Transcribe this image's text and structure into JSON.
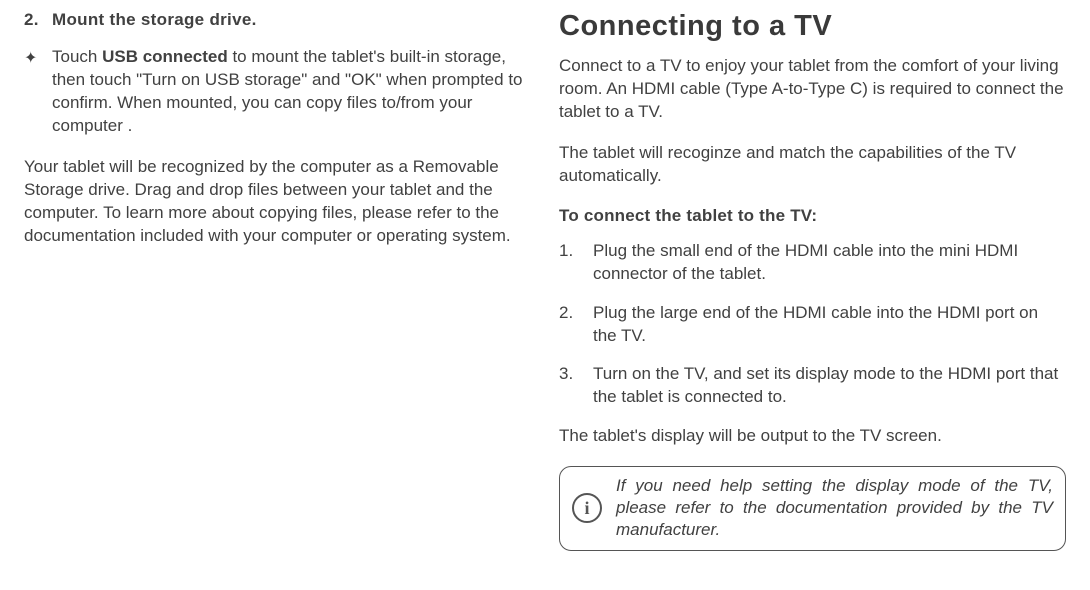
{
  "left": {
    "step_num": "2.",
    "step_title": "Mount the storage drive.",
    "bullet_star": "✦",
    "bullet_pre": "Touch ",
    "bullet_bold": "USB connected",
    "bullet_post": " to mount the tablet's  built-in storage, then touch \"Turn on USB storage\" and \"OK\" when prompted to confirm. When mounted, you can copy files to/from your computer .",
    "para": "Your tablet will be recognized by the computer as a Removable Storage drive. Drag and drop files between your tablet and the computer. To learn more about copying files, please refer to the documentation included with your computer or operating system."
  },
  "right": {
    "title": "Connecting to a TV",
    "intro1": "Connect to a TV to enjoy your tablet from the comfort of your living room. An HDMI cable (Type A-to-Type C) is required to connect the tablet to a TV.",
    "intro2": "The tablet will recoginze and match the capabilities of the TV automatically.",
    "sub": "To connect the tablet to the TV:",
    "steps": [
      {
        "num": "1.",
        "text": "Plug the small end of the HDMI cable into the mini HDMI connector of the tablet."
      },
      {
        "num": "2.",
        "text": "Plug the large end of the HDMI cable into the HDMI port on the TV."
      },
      {
        "num": "3.",
        "text": "Turn on the TV, and set its display mode to the HDMI port that the tablet is connected to."
      }
    ],
    "outro": "The tablet's display will be output to the TV screen.",
    "info_icon": "i",
    "info_text": "If you need help setting the display mode of the TV, please refer to the documentation provided by the TV manufacturer."
  }
}
